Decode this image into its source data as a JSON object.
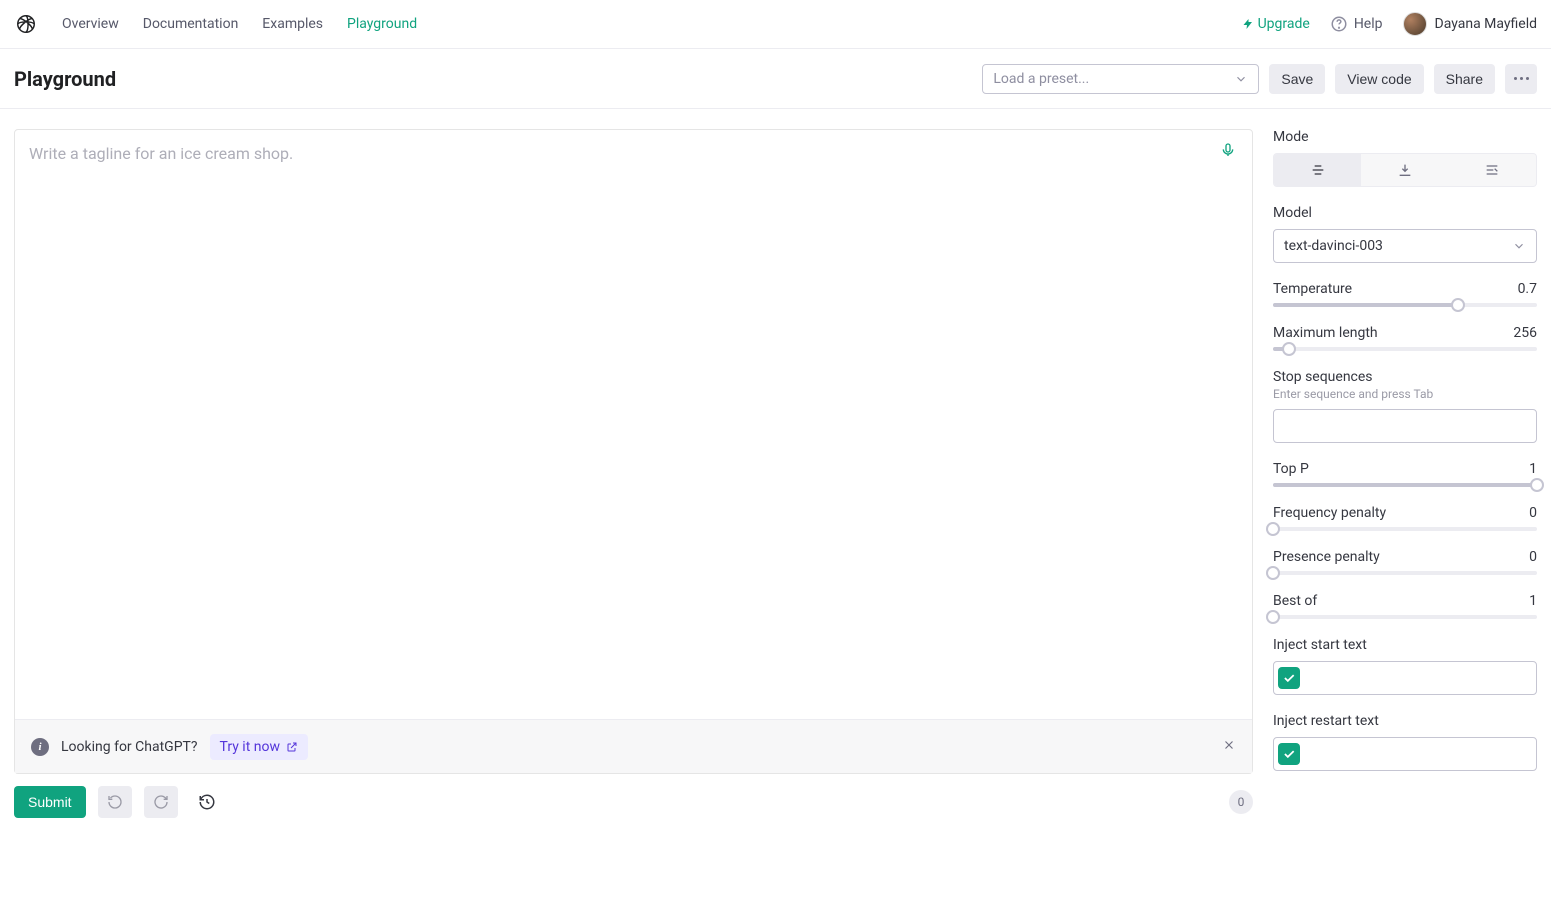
{
  "nav": {
    "links": [
      "Overview",
      "Documentation",
      "Examples",
      "Playground"
    ],
    "upgrade": "Upgrade",
    "help": "Help",
    "user_name": "Dayana Mayfield"
  },
  "header": {
    "title": "Playground",
    "preset_placeholder": "Load a preset...",
    "save": "Save",
    "view_code": "View code",
    "share": "Share"
  },
  "editor": {
    "placeholder": "Write a tagline for an ice cream shop."
  },
  "banner": {
    "text": "Looking for ChatGPT?",
    "cta": "Try it now"
  },
  "footer": {
    "submit": "Submit",
    "counter": "0"
  },
  "sidebar": {
    "mode_label": "Mode",
    "model_label": "Model",
    "model_value": "text-davinci-003",
    "temperature": {
      "label": "Temperature",
      "value": "0.7",
      "pct": 70
    },
    "max_length": {
      "label": "Maximum length",
      "value": "256",
      "pct": 6
    },
    "stop": {
      "label": "Stop sequences",
      "hint": "Enter sequence and press Tab"
    },
    "top_p": {
      "label": "Top P",
      "value": "1",
      "pct": 100
    },
    "freq": {
      "label": "Frequency penalty",
      "value": "0",
      "pct": 0
    },
    "pres": {
      "label": "Presence penalty",
      "value": "0",
      "pct": 0
    },
    "best": {
      "label": "Best of",
      "value": "1",
      "pct": 0
    },
    "inject_start": "Inject start text",
    "inject_restart": "Inject restart text"
  }
}
